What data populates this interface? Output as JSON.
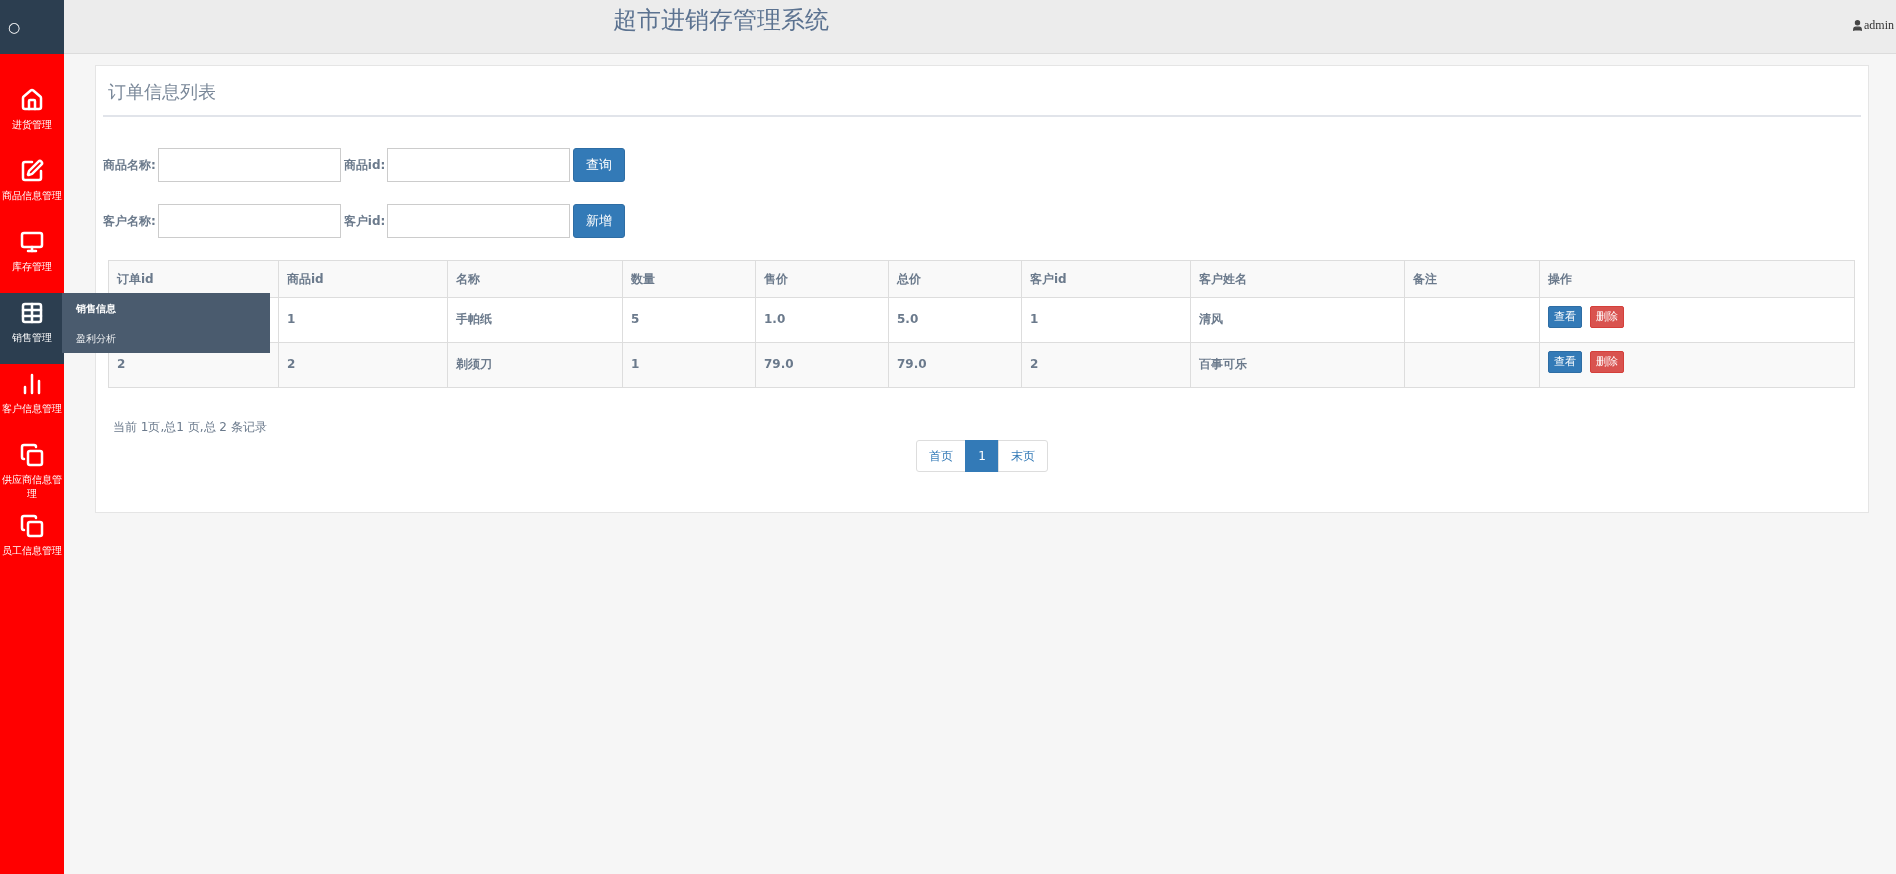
{
  "sidebar": {
    "logo": "○",
    "items": [
      {
        "label": "进货管理",
        "selected": false
      },
      {
        "label": "商品信息管理",
        "selected": false
      },
      {
        "label": "库存管理",
        "selected": false
      },
      {
        "label": "销售管理",
        "selected": true,
        "expanded": true,
        "children": [
          {
            "label": "销售信息",
            "selected": true
          },
          {
            "label": "盈利分析",
            "selected": false
          }
        ]
      },
      {
        "label": "客户信息管理",
        "selected": false
      },
      {
        "label": "供应商信息管理",
        "selected": false
      },
      {
        "label": "员工信息管理",
        "selected": false
      }
    ]
  },
  "header": {
    "title": "超市进销存管理系统",
    "user": "admin"
  },
  "panel": {
    "title": "订单信息列表",
    "filters": [
      [
        {
          "label": "商品名称:"
        },
        {
          "label": "商品id:"
        }
      ],
      [
        {
          "label": "客户名称:"
        },
        {
          "label": "客户id:"
        }
      ]
    ],
    "filter_buttons": [
      "查询",
      "新增"
    ],
    "table": {
      "columns": [
        "订单id",
        "商品id",
        "名称",
        "数量",
        "售价",
        "总价",
        "客户id",
        "客户姓名",
        "备注",
        "操作"
      ],
      "rows": [
        {
          "cells": [
            null,
            "1",
            "手帕纸",
            "5",
            "1.0",
            "5.0",
            "1",
            "清风",
            null
          ],
          "actions": [
            {
              "kind": "primary",
              "label": "查看"
            },
            {
              "kind": "danger",
              "label": "删除"
            }
          ]
        },
        {
          "cells": [
            "2",
            "2",
            "剃须刀",
            "1",
            "79.0",
            "79.0",
            "2",
            "百事可乐",
            null
          ],
          "actions": [
            {
              "kind": "primary",
              "label": "查看"
            },
            {
              "kind": "danger",
              "label": "删除"
            }
          ]
        }
      ]
    },
    "summary": "当前 1页,总1 页,总 2 条记录",
    "pagination": [
      {
        "label": "首页",
        "selected": false
      },
      {
        "label": "1",
        "selected": true
      },
      {
        "label": "末页",
        "selected": false
      }
    ]
  }
}
